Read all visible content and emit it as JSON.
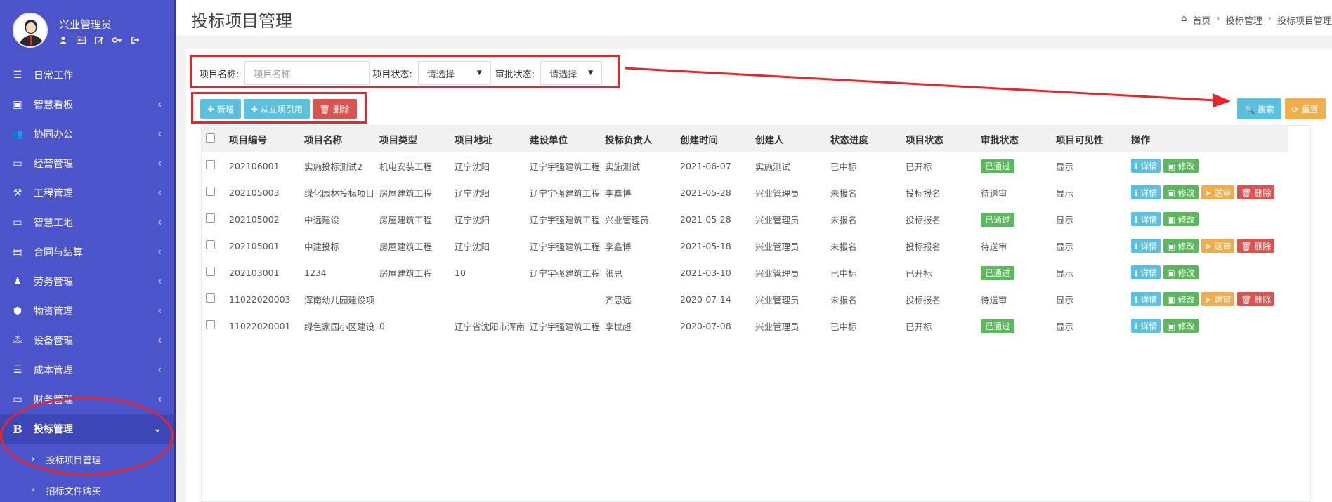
{
  "sidebar": {
    "user_name": "兴业管理员",
    "items": [
      {
        "label": "日常工作",
        "icon": "list-icon",
        "chev": false
      },
      {
        "label": "智慧看板",
        "icon": "dashboard-icon",
        "chev": true
      },
      {
        "label": "协同办公",
        "icon": "users-icon",
        "chev": true
      },
      {
        "label": "经营管理",
        "icon": "monitor-icon",
        "chev": true
      },
      {
        "label": "工程管理",
        "icon": "hammer-icon",
        "chev": true
      },
      {
        "label": "智慧工地",
        "icon": "monitor-icon",
        "chev": true
      },
      {
        "label": "合同与结算",
        "icon": "file-icon",
        "chev": true
      },
      {
        "label": "劳务管理",
        "icon": "worker-icon",
        "chev": true
      },
      {
        "label": "物资管理",
        "icon": "box-icon",
        "chev": true
      },
      {
        "label": "设备管理",
        "icon": "cubes-icon",
        "chev": true
      },
      {
        "label": "成本管理",
        "icon": "list-icon",
        "chev": true
      },
      {
        "label": "财务管理",
        "icon": "monitor-icon",
        "chev": true
      },
      {
        "label": "投标管理",
        "icon": "bold-b-icon",
        "chev": true
      }
    ],
    "sub_items": [
      "投标项目管理",
      "招标文件购买"
    ]
  },
  "header": {
    "title": "投标项目管理",
    "breadcrumb": [
      "首页",
      "投标管理",
      "投标项目管理"
    ]
  },
  "filters": {
    "name_label": "项目名称:",
    "name_placeholder": "项目名称",
    "status_label": "项目状态:",
    "status_value": "请选择",
    "approval_label": "审批状态:",
    "approval_value": "请选择"
  },
  "toolbar": {
    "add": "✚ 新增",
    "cite": "✚ 从立项引用",
    "delete": "🗑 删除",
    "search": "🔍 搜索",
    "reset": "⟳ 重置"
  },
  "table": {
    "headers": [
      "项目编号",
      "项目名称",
      "项目类型",
      "项目地址",
      "建设单位",
      "投标负责人",
      "创建时间",
      "创建人",
      "状态进度",
      "项目状态",
      "审批状态",
      "项目可见性",
      "操作"
    ],
    "rows": [
      {
        "id": "202106001",
        "name": "实施投标测试2",
        "type": "机电安装工程",
        "addr": "辽宁沈阳",
        "unit": "辽宁宇强建筑工程有",
        "leader": "实施测试",
        "time": "2021-06-07",
        "creator": "实施测试",
        "progress": "已中标",
        "status": "已开标",
        "approval": "已通过",
        "visible": "显示",
        "ops": [
          "detail",
          "edit"
        ]
      },
      {
        "id": "202105003",
        "name": "绿化园林投标项目",
        "type": "房屋建筑工程",
        "addr": "辽宁沈阳",
        "unit": "辽宁宇强建筑工程有",
        "leader": "李鑫博",
        "time": "2021-05-28",
        "creator": "兴业管理员",
        "progress": "未报名",
        "status": "投标报名",
        "approval": "待送审",
        "visible": "显示",
        "ops": [
          "detail",
          "edit",
          "send",
          "del"
        ]
      },
      {
        "id": "202105002",
        "name": "中远建设",
        "type": "房屋建筑工程",
        "addr": "辽宁沈阳",
        "unit": "辽宁宇强建筑工程有",
        "leader": "兴业管理员",
        "time": "2021-05-28",
        "creator": "兴业管理员",
        "progress": "未报名",
        "status": "投标报名",
        "approval": "已通过",
        "visible": "显示",
        "ops": [
          "detail",
          "edit"
        ]
      },
      {
        "id": "202105001",
        "name": "中建投标",
        "type": "房屋建筑工程",
        "addr": "辽宁沈阳",
        "unit": "辽宁宇强建筑工程有",
        "leader": "李鑫博",
        "time": "2021-05-18",
        "creator": "兴业管理员",
        "progress": "未报名",
        "status": "投标报名",
        "approval": "待送审",
        "visible": "显示",
        "ops": [
          "detail",
          "edit",
          "send",
          "del"
        ]
      },
      {
        "id": "202103001",
        "name": "1234",
        "type": "房屋建筑工程",
        "addr": "10",
        "unit": "辽宁宇强建筑工程有",
        "leader": "张思",
        "time": "2021-03-10",
        "creator": "兴业管理员",
        "progress": "已中标",
        "status": "已开标",
        "approval": "已通过",
        "visible": "显示",
        "ops": [
          "detail",
          "edit"
        ]
      },
      {
        "id": "11022020003",
        "name": "浑南幼儿园建设项目",
        "type": "",
        "addr": "",
        "unit": "",
        "leader": "齐思远",
        "time": "2020-07-14",
        "creator": "兴业管理员",
        "progress": "未报名",
        "status": "投标报名",
        "approval": "待送审",
        "visible": "显示",
        "ops": [
          "detail",
          "edit",
          "send",
          "del"
        ]
      },
      {
        "id": "11022020001",
        "name": "绿色家园小区建设项",
        "type": "0",
        "addr": "辽宁省沈阳市浑南区",
        "unit": "辽宁宇强建筑工程有",
        "leader": "李世超",
        "time": "2020-07-08",
        "creator": "兴业管理员",
        "progress": "已中标",
        "status": "已开标",
        "approval": "已通过",
        "visible": "显示",
        "ops": [
          "detail",
          "edit"
        ]
      }
    ],
    "op_labels": {
      "detail": "ℹ 详情",
      "edit": "▣ 修改",
      "send": "➤ 送审",
      "del": "🗑 删除"
    }
  },
  "colors": {
    "sidebar": "#4b54c8",
    "info": "#5bc0de",
    "success": "#5cb85c",
    "warning": "#f0ad4e",
    "danger": "#d9534f",
    "annotation": "#e8262a"
  }
}
